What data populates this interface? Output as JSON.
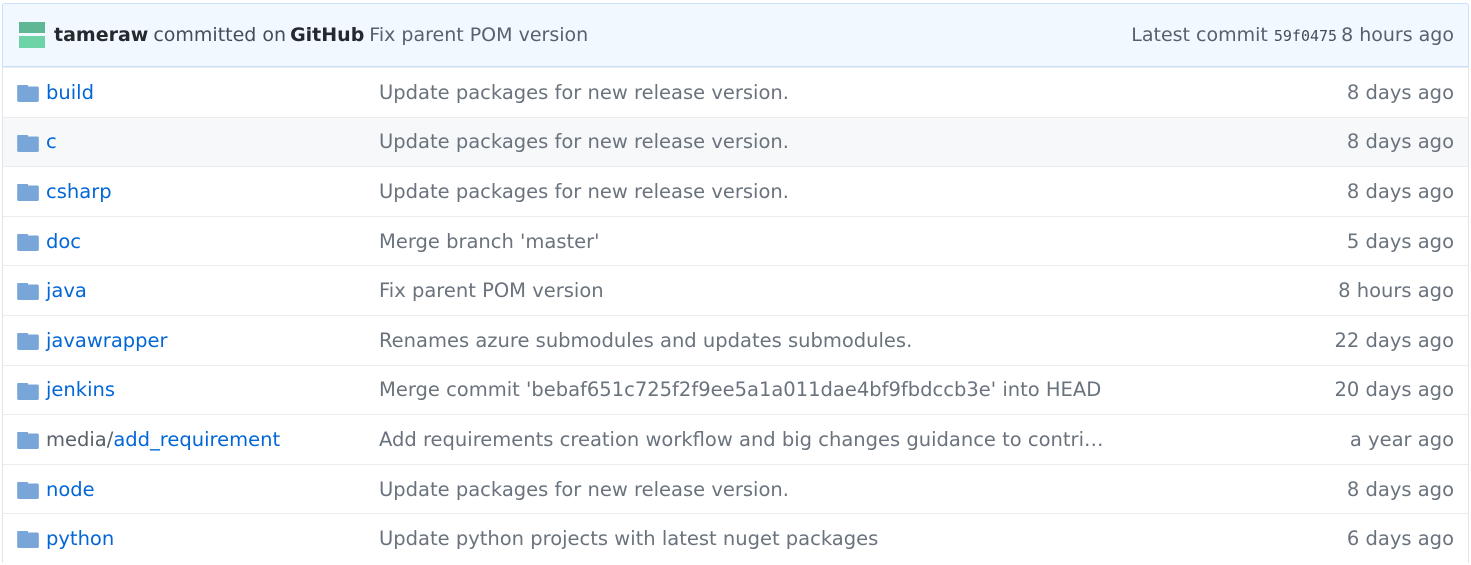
{
  "commit_tease": {
    "author": "tameraw",
    "committed_text": "committed on",
    "via": "GitHub",
    "message": "Fix parent POM version",
    "latest_label": "Latest commit",
    "sha": "59f0475",
    "age": "8 hours ago"
  },
  "colors": {
    "link": "#0366d6",
    "muted": "#6a737d",
    "folder_icon": "#79b8ff",
    "tease_bg": "#f1f8ff"
  },
  "files": [
    {
      "icon": "folder-icon",
      "prefix": "",
      "name": "build",
      "message": "Update packages for new release version.",
      "age": "8 days ago"
    },
    {
      "icon": "folder-icon",
      "prefix": "",
      "name": "c",
      "message": "Update packages for new release version.",
      "age": "8 days ago"
    },
    {
      "icon": "folder-icon",
      "prefix": "",
      "name": "csharp",
      "message": "Update packages for new release version.",
      "age": "8 days ago"
    },
    {
      "icon": "folder-icon",
      "prefix": "",
      "name": "doc",
      "message": "Merge branch 'master'",
      "age": "5 days ago"
    },
    {
      "icon": "folder-icon",
      "prefix": "",
      "name": "java",
      "message": "Fix parent POM version",
      "age": "8 hours ago"
    },
    {
      "icon": "folder-icon",
      "prefix": "",
      "name": "javawrapper",
      "message": "Renames azure submodules and updates submodules.",
      "age": "22 days ago"
    },
    {
      "icon": "folder-icon",
      "prefix": "",
      "name": "jenkins",
      "message": "Merge commit 'bebaf651c725f2f9ee5a1a011dae4bf9fbdccb3e' into HEAD",
      "age": "20 days ago"
    },
    {
      "icon": "folder-icon",
      "prefix": "media/",
      "name": "add_requirement",
      "message": "Add requirements creation workflow and big changes guidance to contri…",
      "age": "a year ago"
    },
    {
      "icon": "folder-icon",
      "prefix": "",
      "name": "node",
      "message": "Update packages for new release version.",
      "age": "8 days ago"
    },
    {
      "icon": "folder-icon",
      "prefix": "",
      "name": "python",
      "message": "Update python projects with latest nuget packages",
      "age": "6 days ago"
    }
  ]
}
